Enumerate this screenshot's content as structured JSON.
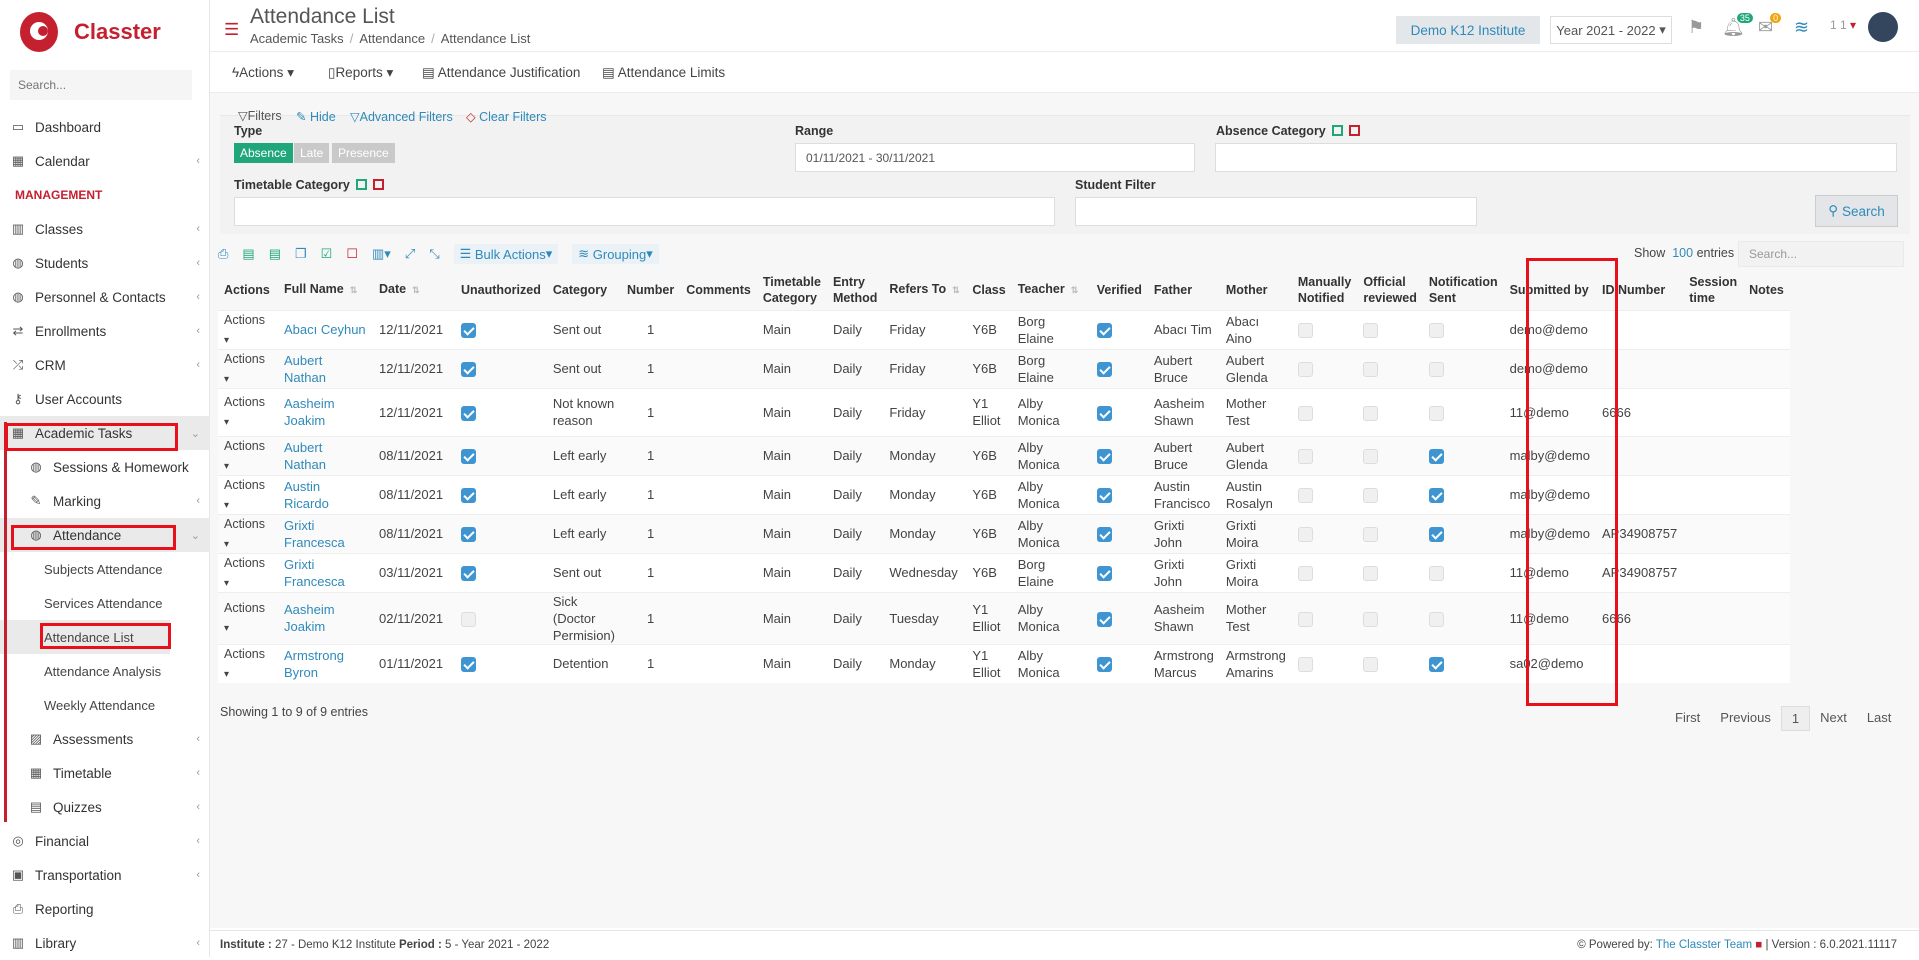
{
  "app": {
    "brand": "Classter",
    "brand_color": "#c4202f",
    "link_color": "#2f8ab9"
  },
  "sidebar": {
    "search_placeholder": "Search...",
    "items": [
      {
        "label": "Dashboard",
        "icon": "laptop-icon"
      },
      {
        "label": "Calendar",
        "icon": "calendar-icon"
      },
      {
        "heading": "MANAGEMENT"
      },
      {
        "label": "Classes",
        "icon": "classes-icon"
      },
      {
        "label": "Students",
        "icon": "students-icon"
      },
      {
        "label": "Personnel & Contacts",
        "icon": "personnel-icon"
      },
      {
        "label": "Enrollments",
        "icon": "enrollments-icon"
      },
      {
        "label": "CRM",
        "icon": "crm-icon"
      },
      {
        "label": "User Accounts",
        "icon": "key-icon"
      },
      {
        "label": "Academic Tasks",
        "icon": "grid-icon"
      },
      {
        "label": "Sessions & Homework",
        "icon": "sessions-icon"
      },
      {
        "label": "Marking",
        "icon": "pencil-icon"
      },
      {
        "label": "Attendance",
        "icon": "attendance-icon"
      },
      {
        "label": "Subjects Attendance"
      },
      {
        "label": "Services Attendance"
      },
      {
        "label": "Attendance List"
      },
      {
        "label": "Attendance Analysis"
      },
      {
        "label": "Weekly Attendance"
      },
      {
        "label": "Assessments",
        "icon": "assessments-icon"
      },
      {
        "label": "Timetable",
        "icon": "timetable-icon"
      },
      {
        "label": "Quizzes",
        "icon": "quizzes-icon"
      },
      {
        "label": "Financial",
        "icon": "coins-icon"
      },
      {
        "label": "Transportation",
        "icon": "bus-icon"
      },
      {
        "label": "Reporting",
        "icon": "printer-icon"
      },
      {
        "label": "Library",
        "icon": "books-icon"
      }
    ]
  },
  "header": {
    "title": "Attendance List",
    "breadcrumb": [
      "Academic Tasks",
      "Attendance",
      "Attendance List"
    ],
    "institute": "Demo K12 Institute",
    "year": "Year 2021 - 2022",
    "notif_count": "35",
    "mail_count": "0",
    "user": "1 1"
  },
  "toolbar": {
    "actions": "Actions",
    "reports": "Reports",
    "justification": "Attendance Justification",
    "limits": "Attendance Limits"
  },
  "filters": {
    "filters": "Filters",
    "hide": "Hide",
    "advanced": "Advanced Filters",
    "clear": "Clear Filters",
    "type_label": "Type",
    "type_options": [
      "Absence",
      "Late",
      "Presence"
    ],
    "range_label": "Range",
    "range_value": "01/11/2021 - 30/11/2021",
    "absence_category_label": "Absence Category",
    "timetable_category_label": "Timetable Category",
    "student_filter_label": "Student Filter",
    "search_button": "Search"
  },
  "table_tools": {
    "bulk": "Bulk Actions",
    "grouping": "Grouping",
    "show": "Show",
    "entries_count": "100",
    "entries": "entries",
    "search_placeholder": "Search..."
  },
  "columns": [
    "Actions",
    "Full Name",
    "Date",
    "Unauthorized",
    "Category",
    "Number",
    "Comments",
    "Timetable Category",
    "Entry Method",
    "Refers To",
    "Class",
    "Teacher",
    "Verified",
    "Father",
    "Mother",
    "Manually Notified",
    "Official reviewed",
    "Notification Sent",
    "Submitted by",
    "ID Number",
    "Session time",
    "Notes"
  ],
  "rows": [
    {
      "actions": "Actions",
      "name": "Abacı Ceyhun",
      "date": "12/11/2021",
      "unauth": true,
      "category": "Sent out",
      "number": "1",
      "comments": "",
      "tt": "Main",
      "entry": "Daily",
      "refers": "Friday",
      "class": "Y6B",
      "teacher": "Borg Elaine",
      "verified": true,
      "father": "Abacı Tim",
      "mother": "Abacı Aino",
      "manual": false,
      "official": false,
      "notif": false,
      "submitted": "demo@demo",
      "id": "",
      "session": "",
      "notes": ""
    },
    {
      "actions": "Actions",
      "name": "Aubert Nathan",
      "date": "12/11/2021",
      "unauth": true,
      "category": "Sent out",
      "number": "1",
      "comments": "",
      "tt": "Main",
      "entry": "Daily",
      "refers": "Friday",
      "class": "Y6B",
      "teacher": "Borg Elaine",
      "verified": true,
      "father": "Aubert Bruce",
      "mother": "Aubert Glenda",
      "manual": false,
      "official": false,
      "notif": false,
      "submitted": "demo@demo",
      "id": "",
      "session": "",
      "notes": ""
    },
    {
      "actions": "Actions",
      "name": "Aasheim Joakim",
      "date": "12/11/2021",
      "unauth": true,
      "category": "Not known reason",
      "number": "1",
      "comments": "",
      "tt": "Main",
      "entry": "Daily",
      "refers": "Friday",
      "class": "Y1 Elliot",
      "teacher": "Alby Monica",
      "verified": true,
      "father": "Aasheim Shawn",
      "mother": "Mother Test",
      "manual": false,
      "official": false,
      "notif": false,
      "submitted": "11@demo",
      "id": "6666",
      "session": "",
      "notes": ""
    },
    {
      "actions": "Actions",
      "name": "Aubert Nathan",
      "date": "08/11/2021",
      "unauth": true,
      "category": "Left early",
      "number": "1",
      "comments": "",
      "tt": "Main",
      "entry": "Daily",
      "refers": "Monday",
      "class": "Y6B",
      "teacher": "Alby Monica",
      "verified": true,
      "father": "Aubert Bruce",
      "mother": "Aubert Glenda",
      "manual": false,
      "official": false,
      "notif": true,
      "submitted": "malby@demo",
      "id": "",
      "session": "",
      "notes": ""
    },
    {
      "actions": "Actions",
      "name": "Austin Ricardo",
      "date": "08/11/2021",
      "unauth": true,
      "category": "Left early",
      "number": "1",
      "comments": "",
      "tt": "Main",
      "entry": "Daily",
      "refers": "Monday",
      "class": "Y6B",
      "teacher": "Alby Monica",
      "verified": true,
      "father": "Austin Francisco",
      "mother": "Austin Rosalyn",
      "manual": false,
      "official": false,
      "notif": true,
      "submitted": "malby@demo",
      "id": "",
      "session": "",
      "notes": ""
    },
    {
      "actions": "Actions",
      "name": "Grixti Francesca",
      "date": "08/11/2021",
      "unauth": true,
      "category": "Left early",
      "number": "1",
      "comments": "",
      "tt": "Main",
      "entry": "Daily",
      "refers": "Monday",
      "class": "Y6B",
      "teacher": "Alby Monica",
      "verified": true,
      "father": "Grixti John",
      "mother": "Grixti Moira",
      "manual": false,
      "official": false,
      "notif": true,
      "submitted": "malby@demo",
      "id": "AP34908757",
      "session": "",
      "notes": ""
    },
    {
      "actions": "Actions",
      "name": "Grixti Francesca",
      "date": "03/11/2021",
      "unauth": true,
      "category": "Sent out",
      "number": "1",
      "comments": "",
      "tt": "Main",
      "entry": "Daily",
      "refers": "Wednesday",
      "class": "Y6B",
      "teacher": "Borg Elaine",
      "verified": true,
      "father": "Grixti John",
      "mother": "Grixti Moira",
      "manual": false,
      "official": false,
      "notif": false,
      "submitted": "11@demo",
      "id": "AP34908757",
      "session": "",
      "notes": ""
    },
    {
      "actions": "Actions",
      "name": "Aasheim Joakim",
      "date": "02/11/2021",
      "unauth": false,
      "category": "Sick (Doctor Permision)",
      "number": "1",
      "comments": "",
      "tt": "Main",
      "entry": "Daily",
      "refers": "Tuesday",
      "class": "Y1 Elliot",
      "teacher": "Alby Monica",
      "verified": true,
      "father": "Aasheim Shawn",
      "mother": "Mother Test",
      "manual": false,
      "official": false,
      "notif": false,
      "submitted": "11@demo",
      "id": "6666",
      "session": "",
      "notes": ""
    },
    {
      "actions": "Actions",
      "name": "Armstrong Byron",
      "date": "01/11/2021",
      "unauth": true,
      "category": "Detention",
      "number": "1",
      "comments": "",
      "tt": "Main",
      "entry": "Daily",
      "refers": "Monday",
      "class": "Y1 Elliot",
      "teacher": "Alby Monica",
      "verified": true,
      "father": "Armstrong Marcus",
      "mother": "Armstrong Amarins",
      "manual": false,
      "official": false,
      "notif": true,
      "submitted": "sa02@demo",
      "id": "",
      "session": "",
      "notes": ""
    }
  ],
  "footer": {
    "showing": "Showing 1 to 9 of 9 entries",
    "pager": [
      "First",
      "Previous",
      "1",
      "Next",
      "Last"
    ],
    "institute_label": "Institute :",
    "institute_value": "27 - Demo K12 Institute",
    "period_label": "Period :",
    "period_value": "5 - Year 2021 - 2022",
    "powered_by": "Powered by:",
    "team": "The Classter Team",
    "version": "| Version : 6.0.2021.11117"
  }
}
